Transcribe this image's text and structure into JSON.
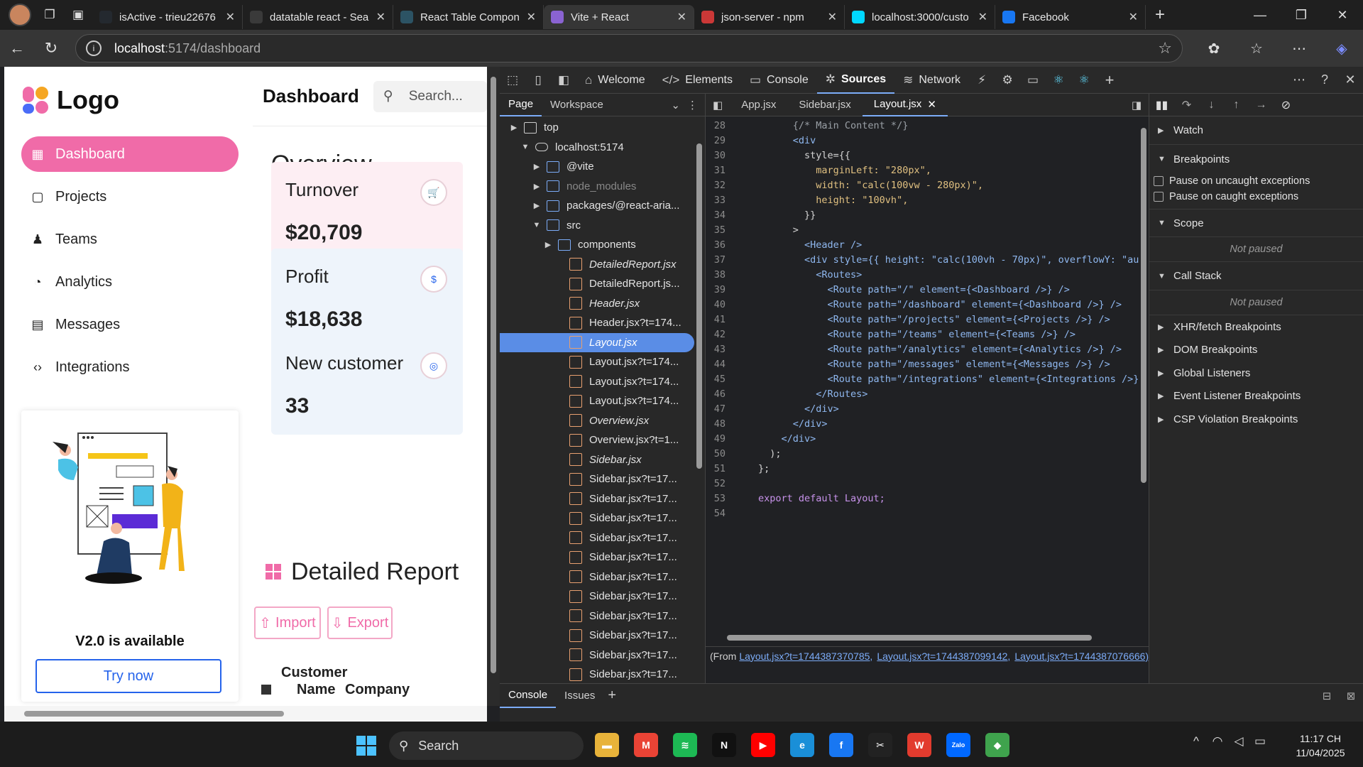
{
  "browser": {
    "tabs": [
      {
        "title": "isActive - trieu22676",
        "icon": "github-icon",
        "color": "#24292f"
      },
      {
        "title": "datatable react - Sea",
        "icon": "search-icon",
        "color": "#3a3a3a"
      },
      {
        "title": "React Table Compon",
        "icon": "react-table-icon",
        "color": "#2c5364"
      },
      {
        "title": "Vite + React",
        "icon": "vite-icon",
        "color": "#8a63d2"
      },
      {
        "title": "json-server - npm",
        "icon": "npm-icon",
        "color": "#cb3837"
      },
      {
        "title": "localhost:3000/custo",
        "icon": "react-icon",
        "color": "#00d8ff"
      },
      {
        "title": "Facebook",
        "icon": "facebook-icon",
        "color": "#1877f2"
      }
    ],
    "active_tab": 3,
    "url_host": "localhost",
    "url_path": ":5174/dashboard"
  },
  "app": {
    "logo": "Logo",
    "nav": [
      {
        "label": "Dashboard",
        "icon": "grid-icon",
        "glyph": "▦",
        "active": true
      },
      {
        "label": "Projects",
        "icon": "folder-icon",
        "glyph": "▢",
        "active": false
      },
      {
        "label": "Teams",
        "icon": "teams-icon",
        "glyph": "♟",
        "active": false
      },
      {
        "label": "Analytics",
        "icon": "analytics-icon",
        "glyph": "◔",
        "active": false
      },
      {
        "label": "Messages",
        "icon": "messages-icon",
        "glyph": "▤",
        "active": false
      },
      {
        "label": "Integrations",
        "icon": "code-icon",
        "glyph": "‹›",
        "active": false
      }
    ],
    "promo": {
      "title": "V2.0 is available",
      "button": "Try now"
    },
    "header": {
      "title": "Dashboard",
      "search_placeholder": "Search..."
    },
    "overview_title": "Overview",
    "cards": [
      {
        "label": "Turnover",
        "value": "$20,709",
        "icon": "cart-icon",
        "glyph": "🛒",
        "bg": "#fdeef3"
      },
      {
        "label": "Profit",
        "value": "$18,638",
        "icon": "dollar-icon",
        "glyph": "$",
        "bg": "#eef4fb"
      },
      {
        "label": "New customer",
        "value": "33",
        "icon": "customer-icon",
        "glyph": "◎",
        "bg": "#eef4fb"
      }
    ],
    "report": {
      "title": "Detailed Report",
      "import": "Import",
      "export": "Export"
    },
    "table_headers": [
      "Customer",
      "Name",
      "Company"
    ]
  },
  "devtools": {
    "tabs": [
      {
        "label": "Welcome",
        "icon": "home-icon",
        "glyph": "⌂"
      },
      {
        "label": "Elements",
        "icon": "elements-icon",
        "glyph": "</>"
      },
      {
        "label": "Console",
        "icon": "console-icon",
        "glyph": "▭"
      },
      {
        "label": "Sources",
        "icon": "sources-icon",
        "glyph": "✲"
      },
      {
        "label": "Network",
        "icon": "network-icon",
        "glyph": "≋"
      }
    ],
    "active_tab": "Sources",
    "navigator_tabs": [
      "Page",
      "Workspace"
    ],
    "tree": [
      {
        "label": "top",
        "type": "frame",
        "depth": 0,
        "arrow": "▶"
      },
      {
        "label": "localhost:5174",
        "type": "cloud",
        "depth": 1,
        "arrow": "▼"
      },
      {
        "label": "@vite",
        "type": "folder",
        "depth": 2,
        "arrow": "▶"
      },
      {
        "label": "node_modules",
        "type": "folder",
        "depth": 2,
        "arrow": "▶",
        "dim": true
      },
      {
        "label": "packages/@react-aria...",
        "type": "folder",
        "depth": 2,
        "arrow": "▶"
      },
      {
        "label": "src",
        "type": "folder",
        "depth": 2,
        "arrow": "▼"
      },
      {
        "label": "components",
        "type": "folder",
        "depth": 3,
        "arrow": "▶"
      },
      {
        "label": "DetailedReport.jsx",
        "type": "file",
        "depth": 4,
        "italic": true
      },
      {
        "label": "DetailedReport.js...",
        "type": "file",
        "depth": 4
      },
      {
        "label": "Header.jsx",
        "type": "file",
        "depth": 4,
        "italic": true
      },
      {
        "label": "Header.jsx?t=174...",
        "type": "file",
        "depth": 4
      },
      {
        "label": "Layout.jsx",
        "type": "file",
        "depth": 4,
        "italic": true,
        "selected": true
      },
      {
        "label": "Layout.jsx?t=174...",
        "type": "file",
        "depth": 4
      },
      {
        "label": "Layout.jsx?t=174...",
        "type": "file",
        "depth": 4
      },
      {
        "label": "Layout.jsx?t=174...",
        "type": "file",
        "depth": 4
      },
      {
        "label": "Overview.jsx",
        "type": "file",
        "depth": 4,
        "italic": true
      },
      {
        "label": "Overview.jsx?t=1...",
        "type": "file",
        "depth": 4
      },
      {
        "label": "Sidebar.jsx",
        "type": "file",
        "depth": 4,
        "italic": true
      },
      {
        "label": "Sidebar.jsx?t=17...",
        "type": "file",
        "depth": 4
      },
      {
        "label": "Sidebar.jsx?t=17...",
        "type": "file",
        "depth": 4
      },
      {
        "label": "Sidebar.jsx?t=17...",
        "type": "file",
        "depth": 4
      },
      {
        "label": "Sidebar.jsx?t=17...",
        "type": "file",
        "depth": 4
      },
      {
        "label": "Sidebar.jsx?t=17...",
        "type": "file",
        "depth": 4
      },
      {
        "label": "Sidebar.jsx?t=17...",
        "type": "file",
        "depth": 4
      },
      {
        "label": "Sidebar.jsx?t=17...",
        "type": "file",
        "depth": 4
      },
      {
        "label": "Sidebar.jsx?t=17...",
        "type": "file",
        "depth": 4
      },
      {
        "label": "Sidebar.jsx?t=17...",
        "type": "file",
        "depth": 4
      },
      {
        "label": "Sidebar.jsx?t=17...",
        "type": "file",
        "depth": 4
      },
      {
        "label": "Sidebar.jsx?t=17...",
        "type": "file",
        "depth": 4
      }
    ],
    "editor_tabs": [
      {
        "label": "App.jsx",
        "active": false
      },
      {
        "label": "Sidebar.jsx",
        "active": false
      },
      {
        "label": "Layout.jsx",
        "active": true
      }
    ],
    "code": [
      {
        "n": "28",
        "t": "      {/* Main Content */}"
      },
      {
        "n": "29",
        "t": "      <div"
      },
      {
        "n": "30",
        "t": "        style={{"
      },
      {
        "n": "31",
        "t": "          marginLeft: \"280px\","
      },
      {
        "n": "32",
        "t": "          width: \"calc(100vw - 280px)\","
      },
      {
        "n": "33",
        "t": "          height: \"100vh\","
      },
      {
        "n": "34",
        "t": "        }}"
      },
      {
        "n": "35",
        "t": "      >"
      },
      {
        "n": "36",
        "t": "        <Header />"
      },
      {
        "n": "37",
        "t": "        <div style={{ height: \"calc(100vh - 70px)\", overflowY: \"au"
      },
      {
        "n": "38",
        "t": "          <Routes>"
      },
      {
        "n": "39",
        "t": "            <Route path=\"/\" element={<Dashboard />} />"
      },
      {
        "n": "40",
        "t": "            <Route path=\"/dashboard\" element={<Dashboard />} />"
      },
      {
        "n": "41",
        "t": "            <Route path=\"/projects\" element={<Projects />} />"
      },
      {
        "n": "42",
        "t": "            <Route path=\"/teams\" element={<Teams />} />"
      },
      {
        "n": "43",
        "t": "            <Route path=\"/analytics\" element={<Analytics />} />"
      },
      {
        "n": "44",
        "t": "            <Route path=\"/messages\" element={<Messages />} />"
      },
      {
        "n": "45",
        "t": "            <Route path=\"/integrations\" element={<Integrations />}"
      },
      {
        "n": "46",
        "t": "          </Routes>"
      },
      {
        "n": "47",
        "t": "        </div>"
      },
      {
        "n": "48",
        "t": "      </div>"
      },
      {
        "n": "49",
        "t": "    </div>"
      },
      {
        "n": "50",
        "t": "  );"
      },
      {
        "n": "51",
        "t": "};"
      },
      {
        "n": "52",
        "t": ""
      },
      {
        "n": "53",
        "t": "export default Layout;"
      },
      {
        "n": "54",
        "t": ""
      }
    ],
    "from_prefix": "(From",
    "from_links": [
      "Layout.jsx?t=1744387370785,",
      "Layout.jsx?t=1744387099142,",
      "Layout.jsx?t=1744387076666)"
    ],
    "debugger": {
      "sections": [
        {
          "label": "Watch",
          "open": false
        },
        {
          "label": "Breakpoints",
          "open": true
        }
      ],
      "checks": [
        "Pause on uncaught exceptions",
        "Pause on caught exceptions"
      ],
      "scope": "Scope",
      "callstack": "Call Stack",
      "not_paused": "Not paused",
      "more": [
        "XHR/fetch Breakpoints",
        "DOM Breakpoints",
        "Global Listeners",
        "Event Listener Breakpoints",
        "CSP Violation Breakpoints"
      ]
    },
    "drawer_tabs": [
      "Console",
      "Issues"
    ]
  },
  "taskbar": {
    "search": "Search",
    "apps": [
      {
        "icon": "file-explorer-icon",
        "color": "#e8b33a",
        "glyph": "▬"
      },
      {
        "icon": "gmail-icon",
        "color": "#ea4335",
        "glyph": "M"
      },
      {
        "icon": "spotify-icon",
        "color": "#1db954",
        "glyph": "≋"
      },
      {
        "icon": "netflix-icon",
        "color": "#111111",
        "glyph": "N"
      },
      {
        "icon": "youtube-icon",
        "color": "#ff0000",
        "glyph": "▶"
      },
      {
        "icon": "edge-icon",
        "color": "#1a8fd8",
        "glyph": "e"
      },
      {
        "icon": "facebook-icon",
        "color": "#1877f2",
        "glyph": "f"
      },
      {
        "icon": "capcut-icon",
        "color": "#222222",
        "glyph": "✂"
      },
      {
        "icon": "wps-icon",
        "color": "#e23b2e",
        "glyph": "W"
      },
      {
        "icon": "zalo-icon",
        "color": "#0068ff",
        "glyph": "Zalo"
      },
      {
        "icon": "git-icon",
        "color": "#3fa34d",
        "glyph": "◆"
      }
    ],
    "time": "11:17 CH",
    "date": "11/04/2025"
  }
}
